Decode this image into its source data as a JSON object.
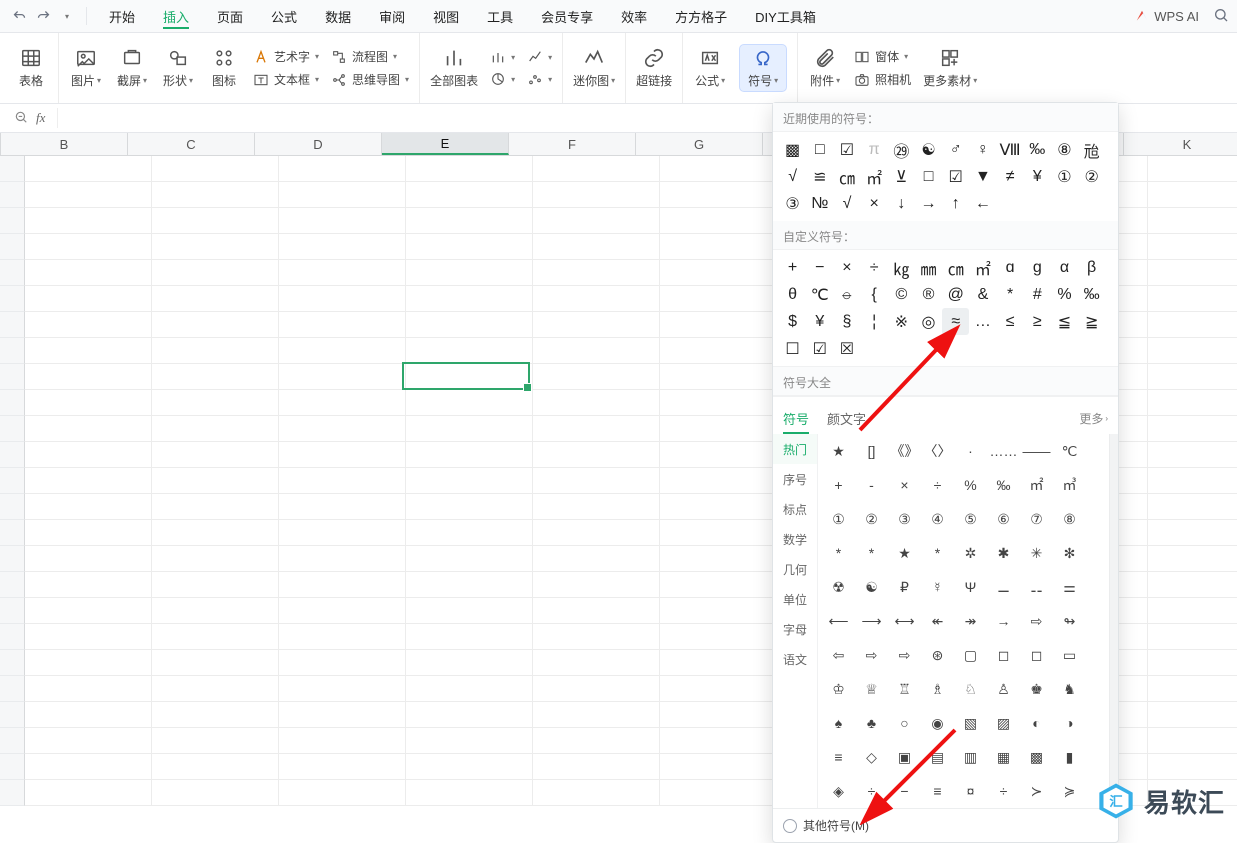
{
  "titlebar": {
    "ai_label": "WPS AI"
  },
  "menu": {
    "items": [
      "开始",
      "插入",
      "页面",
      "公式",
      "数据",
      "审阅",
      "视图",
      "工具",
      "会员专享",
      "效率",
      "方方格子",
      "DIY工具箱"
    ],
    "activeIndex": 1
  },
  "ribbon": {
    "r1": "表格",
    "r2": "图片",
    "r3": "截屏",
    "r4": "形状",
    "r5": "图标",
    "r6a": "艺术字",
    "r6b": "流程图",
    "r6c": "文本框",
    "r6d": "思维导图",
    "r7": "全部图表",
    "r10": "迷你图",
    "r11": "超链接",
    "r12": "公式",
    "r13": "符号",
    "r14": "附件",
    "r15a": "窗体",
    "r15b": "照相机",
    "r16": "更多素材"
  },
  "fx": {
    "fx_label": "fx"
  },
  "columns": [
    "B",
    "C",
    "D",
    "E",
    "F",
    "G",
    "",
    "K"
  ],
  "active_col_index": 3,
  "selection_note": "E 列被选中，活动单元格大约在 E8",
  "panel": {
    "recent_title": "近期使用的符号：",
    "custom_title": "自定义符号：",
    "all_title": "符号大全",
    "tabs": [
      "符号",
      "颜文字"
    ],
    "more": "更多",
    "categories": [
      "热门",
      "序号",
      "标点",
      "数学",
      "几何",
      "单位",
      "字母",
      "语文"
    ],
    "recent": [
      "▩",
      "□",
      "☑",
      "π",
      "㉙",
      "☯",
      "♂",
      "♀",
      "Ⅷ",
      "‰",
      "⑧",
      "兘",
      "√",
      "≌",
      "㎝",
      "㎡",
      "⊻",
      "□",
      "☑",
      "▼",
      "≠",
      "¥",
      "①",
      "②",
      "③",
      "№",
      "√",
      "×",
      "↓",
      "→",
      "↑",
      "←"
    ],
    "custom": [
      "+",
      "−",
      "×",
      "÷",
      "㎏",
      "㎜",
      "㎝",
      "㎡",
      "ɑ",
      "g",
      "α",
      "β",
      "θ",
      "℃",
      "⦵",
      "{",
      "©",
      "®",
      "@",
      "&",
      "*",
      "#",
      "%",
      "‰",
      "$",
      "¥",
      "§",
      "¦",
      "※",
      "◎",
      "≈",
      "…",
      "≤",
      "≥",
      "≦",
      "≧",
      "☐",
      "☑",
      "☒"
    ],
    "highlight_index": 30,
    "hot_rows": [
      [
        "★",
        "[]",
        "《》",
        "〈〉",
        "·",
        "……",
        "——",
        "℃"
      ],
      [
        "+",
        "-",
        "×",
        "÷",
        "%",
        "‰",
        "㎡",
        "㎥"
      ],
      [
        "①",
        "②",
        "③",
        "④",
        "⑤",
        "⑥",
        "⑦",
        "⑧"
      ],
      [
        "*",
        "*",
        "★",
        "*",
        "✲",
        "✱",
        "✳",
        "✻"
      ],
      [
        "☢",
        "☯",
        "₽",
        "☿",
        "Ψ",
        "⚊",
        "⚋",
        "⚌"
      ],
      [
        "⟵",
        "⟶",
        "⟷",
        "↞",
        "↠",
        "→",
        "⇨",
        "↬"
      ],
      [
        "⇦",
        "⇨",
        "⇨",
        "⊛",
        "▢",
        "◻",
        "◻",
        "▭"
      ],
      [
        "♔",
        "♕",
        "♖",
        "♗",
        "♘",
        "♙",
        "♚",
        "♞"
      ],
      [
        "♠",
        "♣",
        "○",
        "◉",
        "▧",
        "▨",
        "◐",
        "◑"
      ],
      [
        "≡",
        "◇",
        "▣",
        "▤",
        "▥",
        "▦",
        "▩",
        "▮"
      ],
      [
        "◈",
        "÷",
        "−",
        "≡",
        "¤",
        "÷",
        "≻",
        "≽"
      ]
    ],
    "footer": "其他符号(M)"
  },
  "watermark": "易软汇"
}
